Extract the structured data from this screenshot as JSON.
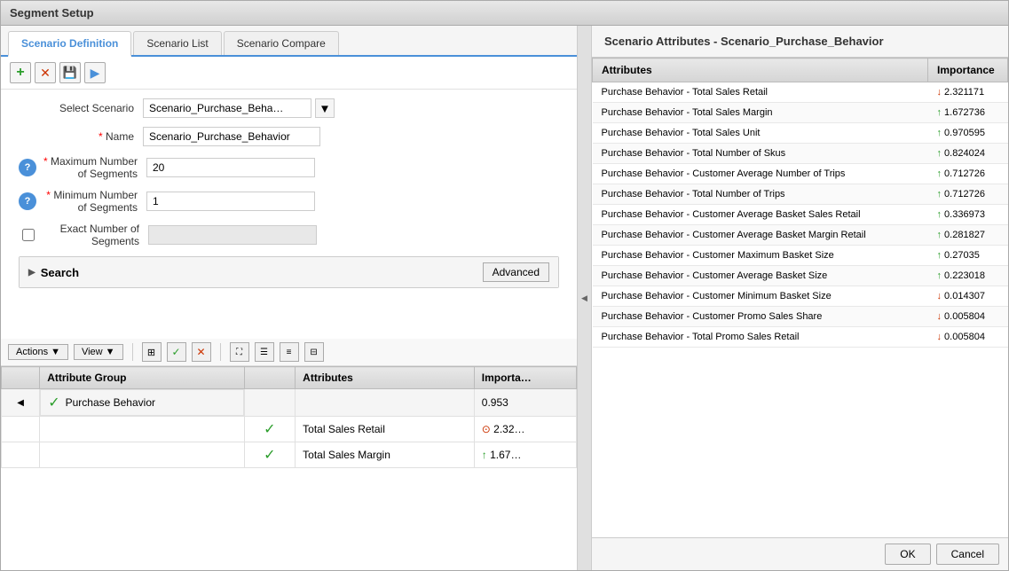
{
  "window": {
    "title": "Segment Setup"
  },
  "tabs": [
    {
      "id": "scenario-definition",
      "label": "Scenario Definition",
      "active": true
    },
    {
      "id": "scenario-list",
      "label": "Scenario List",
      "active": false
    },
    {
      "id": "scenario-compare",
      "label": "Scenario Compare",
      "active": false
    }
  ],
  "toolbar": {
    "add_icon": "+",
    "delete_icon": "✕",
    "save_icon": "💾",
    "run_icon": "▶"
  },
  "form": {
    "select_scenario_label": "Select Scenario",
    "select_scenario_value": "Scenario_Purchase_Beha…",
    "name_label": "Name",
    "name_value": "Scenario_Purchase_Behavior",
    "max_segments_label": "Maximum Number of Segments",
    "max_segments_value": "20",
    "min_segments_label": "Minimum Number of Segments",
    "min_segments_value": "1",
    "exact_segments_label": "Exact Number of Segments",
    "exact_segments_value": ""
  },
  "search": {
    "label": "Search",
    "advanced_btn": "Advanced"
  },
  "grid_toolbar": {
    "actions_label": "Actions",
    "view_label": "View"
  },
  "grid": {
    "columns": [
      "",
      "Attribute Group",
      "",
      "Attributes",
      "Importa…"
    ],
    "rows": [
      {
        "type": "group",
        "checked": true,
        "group": "Purchase Behavior",
        "importance": "0.953"
      },
      {
        "type": "data",
        "checked": true,
        "attribute": "Total Sales Retail",
        "direction": "down",
        "importance": "2.32…"
      },
      {
        "type": "data",
        "checked": true,
        "attribute": "Total Sales Margin",
        "direction": "up",
        "importance": "1.67…"
      }
    ]
  },
  "right_panel": {
    "title": "Scenario Attributes - Scenario_Purchase_Behavior",
    "col_attributes": "Attributes",
    "col_importance": "Importance",
    "rows": [
      {
        "attribute": "Purchase Behavior - Total Sales Retail",
        "direction": "down",
        "importance": "2.321171"
      },
      {
        "attribute": "Purchase Behavior - Total Sales Margin",
        "direction": "up",
        "importance": "1.672736"
      },
      {
        "attribute": "Purchase Behavior - Total Sales Unit",
        "direction": "up",
        "importance": "0.970595"
      },
      {
        "attribute": "Purchase Behavior - Total Number of Skus",
        "direction": "up",
        "importance": "0.824024"
      },
      {
        "attribute": "Purchase Behavior - Customer Average Number of Trips",
        "direction": "up",
        "importance": "0.712726"
      },
      {
        "attribute": "Purchase Behavior - Total Number of Trips",
        "direction": "up",
        "importance": "0.712726"
      },
      {
        "attribute": "Purchase Behavior - Customer Average Basket Sales Retail",
        "direction": "up",
        "importance": "0.336973"
      },
      {
        "attribute": "Purchase Behavior - Customer Average Basket Margin Retail",
        "direction": "up",
        "importance": "0.281827"
      },
      {
        "attribute": "Purchase Behavior - Customer Maximum Basket Size",
        "direction": "up",
        "importance": "0.27035"
      },
      {
        "attribute": "Purchase Behavior - Customer Average Basket Size",
        "direction": "up",
        "importance": "0.223018"
      },
      {
        "attribute": "Purchase Behavior - Customer Minimum Basket Size",
        "direction": "down",
        "importance": "0.014307"
      },
      {
        "attribute": "Purchase Behavior - Customer Promo Sales Share",
        "direction": "down",
        "importance": "0.005804"
      },
      {
        "attribute": "Purchase Behavior - Total Promo Sales Retail",
        "direction": "down",
        "importance": "0.005804"
      }
    ]
  },
  "footer": {
    "ok_label": "OK",
    "cancel_label": "Cancel"
  }
}
